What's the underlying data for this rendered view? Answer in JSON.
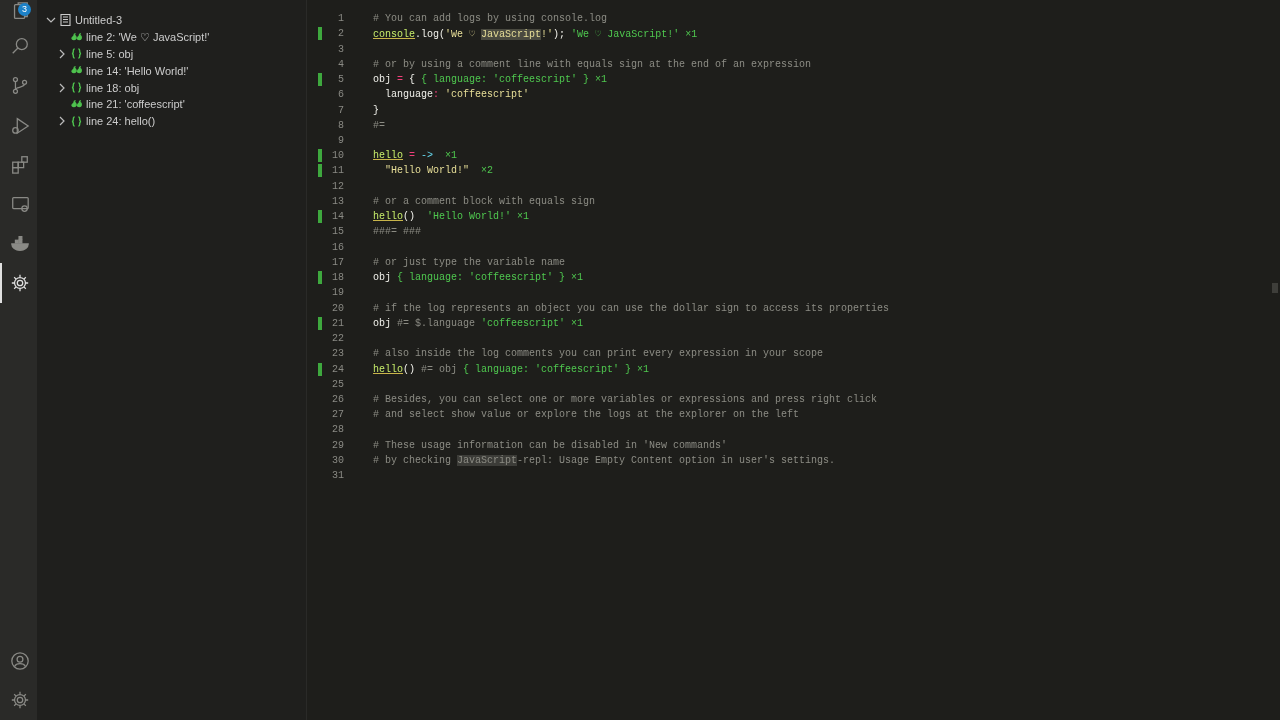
{
  "activity_bar": {
    "items": [
      {
        "kind": "files",
        "selected": false,
        "badge": "3"
      },
      {
        "kind": "search",
        "selected": false
      },
      {
        "kind": "branch",
        "selected": false
      },
      {
        "kind": "debug",
        "selected": false
      },
      {
        "kind": "extensions",
        "selected": false
      },
      {
        "kind": "monitor",
        "selected": false
      },
      {
        "kind": "whale",
        "selected": false
      },
      {
        "kind": "gear",
        "selected": true
      }
    ],
    "bottom_items": [
      {
        "kind": "account",
        "selected": false
      },
      {
        "kind": "gear",
        "selected": false
      }
    ]
  },
  "logs_explorer": {
    "tree": [
      {
        "label": "Untitled-3",
        "expanded": true,
        "children": [
          {
            "kind": "string",
            "label": "line 2: 'We ♡ JavaScript!'"
          },
          {
            "kind": "object",
            "label": "line 5: obj",
            "expanded": false
          },
          {
            "kind": "string",
            "label": "line 14: 'Hello World!'"
          },
          {
            "kind": "object",
            "label": "line 18: obj",
            "expanded": false
          },
          {
            "kind": "string",
            "label": "line 21: 'coffeescript'"
          },
          {
            "kind": "object",
            "label": "line 24: hello()",
            "expanded": false
          }
        ]
      }
    ]
  },
  "editor": {
    "lines": [
      {
        "number": "1",
        "logged": false,
        "segments": [
          {
            "kind": "comment",
            "text": "# You can add logs by using console.log"
          }
        ]
      },
      {
        "number": "2",
        "logged": true,
        "segments": [
          {
            "kind": "fn",
            "text": "console"
          },
          {
            "kind": "plain",
            "text": ".log("
          },
          {
            "kind": "str",
            "text": "'We ♡ "
          },
          {
            "kind": "match",
            "text": "JavaScript"
          },
          {
            "kind": "str",
            "text": "!'"
          },
          {
            "kind": "plain",
            "text": ");"
          },
          {
            "kind": "result",
            "text": " 'We ♡ JavaScript!' ×1"
          }
        ]
      },
      {
        "number": "3",
        "logged": false
      },
      {
        "number": "4",
        "logged": false,
        "segments": [
          {
            "kind": "comment",
            "text": "# or by using a comment line with equals sign at the end of an expression"
          }
        ]
      },
      {
        "number": "5",
        "logged": true,
        "segments": [
          {
            "kind": "plain",
            "text": "obj"
          },
          {
            "kind": "op",
            "text": " = "
          },
          {
            "kind": "plain",
            "text": "{ "
          },
          {
            "kind": "result",
            "text": "{ language: 'coffeescript' } ×1"
          }
        ]
      },
      {
        "number": "6",
        "logged": false,
        "segments": [
          {
            "kind": "plain",
            "text": "  language"
          },
          {
            "kind": "op",
            "text": ":"
          },
          {
            "kind": "str",
            "text": " 'coffeescript'"
          }
        ]
      },
      {
        "number": "7",
        "logged": false,
        "segments": [
          {
            "kind": "plain",
            "text": "}"
          }
        ]
      },
      {
        "number": "8",
        "logged": false,
        "segments": [
          {
            "kind": "comment",
            "text": "#="
          }
        ]
      },
      {
        "number": "9",
        "logged": false
      },
      {
        "number": "10",
        "logged": true,
        "segments": [
          {
            "kind": "fn",
            "text": "hello"
          },
          {
            "kind": "op",
            "text": " = "
          },
          {
            "kind": "arrow",
            "text": "->"
          },
          {
            "kind": "result",
            "text": "  ×1"
          }
        ]
      },
      {
        "number": "11",
        "logged": true,
        "segments": [
          {
            "kind": "str",
            "text": "  \"Hello World!\""
          },
          {
            "kind": "result",
            "text": "  ×2"
          }
        ]
      },
      {
        "number": "12",
        "logged": false
      },
      {
        "number": "13",
        "logged": false,
        "segments": [
          {
            "kind": "comment",
            "text": "# or a comment block with equals sign"
          }
        ]
      },
      {
        "number": "14",
        "logged": true,
        "segments": [
          {
            "kind": "fn",
            "text": "hello"
          },
          {
            "kind": "plain",
            "text": "()"
          },
          {
            "kind": "result",
            "text": "  'Hello World!' ×1"
          }
        ]
      },
      {
        "number": "15",
        "logged": false,
        "segments": [
          {
            "kind": "comment",
            "text": "###= ###"
          }
        ]
      },
      {
        "number": "16",
        "logged": false
      },
      {
        "number": "17",
        "logged": false,
        "segments": [
          {
            "kind": "comment",
            "text": "# or just type the variable name"
          }
        ]
      },
      {
        "number": "18",
        "logged": true,
        "segments": [
          {
            "kind": "plain",
            "text": "obj"
          },
          {
            "kind": "result",
            "text": " { language: 'coffeescript' } ×1"
          }
        ]
      },
      {
        "number": "19",
        "logged": false
      },
      {
        "number": "20",
        "logged": false,
        "segments": [
          {
            "kind": "comment",
            "text": "# if the log represents an object you can use the dollar sign to access its properties"
          }
        ]
      },
      {
        "number": "21",
        "logged": true,
        "segments": [
          {
            "kind": "plain",
            "text": "obj"
          },
          {
            "kind": "comment",
            "text": " #= $.language"
          },
          {
            "kind": "result",
            "text": " 'coffeescript' ×1"
          }
        ]
      },
      {
        "number": "22",
        "logged": false
      },
      {
        "number": "23",
        "logged": false,
        "segments": [
          {
            "kind": "comment",
            "text": "# also inside the log comments you can print every expression in your scope"
          }
        ]
      },
      {
        "number": "24",
        "logged": true,
        "segments": [
          {
            "kind": "fn",
            "text": "hello"
          },
          {
            "kind": "plain",
            "text": "()"
          },
          {
            "kind": "comment",
            "text": " #= obj"
          },
          {
            "kind": "result",
            "text": " { language: 'coffeescript' } ×1"
          }
        ]
      },
      {
        "number": "25",
        "logged": false
      },
      {
        "number": "26",
        "logged": false,
        "segments": [
          {
            "kind": "comment",
            "text": "# Besides, you can select one or more variables or expressions and press right click"
          }
        ]
      },
      {
        "number": "27",
        "logged": false,
        "segments": [
          {
            "kind": "comment",
            "text": "# and select show value or explore the logs at the explorer on the left"
          }
        ]
      },
      {
        "number": "28",
        "logged": false
      },
      {
        "number": "29",
        "logged": false,
        "segments": [
          {
            "kind": "comment",
            "text": "# These usage information can be disabled in 'New commands'"
          }
        ]
      },
      {
        "number": "30",
        "logged": false,
        "segments": [
          {
            "kind": "comment",
            "text": "# by checking "
          },
          {
            "kind": "dimmatch",
            "text": "JavaScript"
          },
          {
            "kind": "comment",
            "text": "-repl: Usage Empty Content option in user's settings."
          }
        ]
      },
      {
        "number": "31",
        "logged": false
      }
    ]
  }
}
